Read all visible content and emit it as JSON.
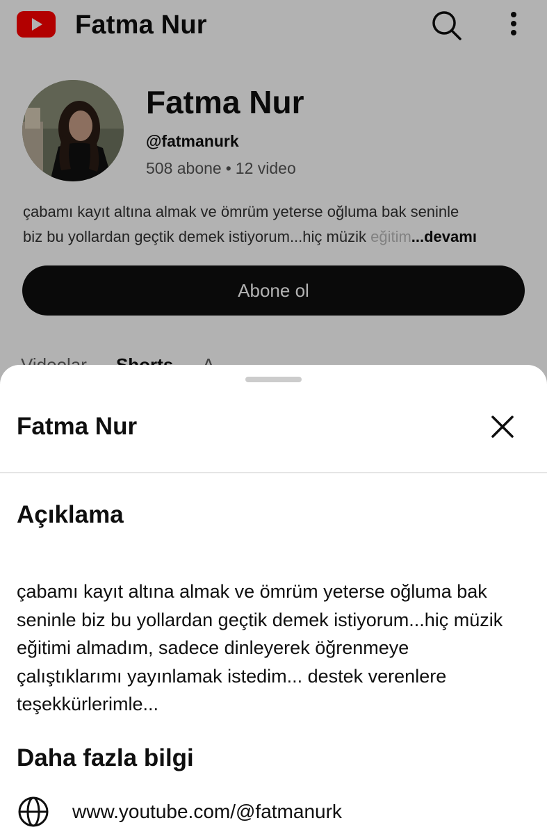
{
  "app": {
    "title": "Fatma Nur",
    "logo_icon": "youtube-logo-icon",
    "brand_color": "#ff0000"
  },
  "channel": {
    "name": "Fatma Nur",
    "handle": "@fatmanurk",
    "subscribers": "508 abone",
    "separator": "•",
    "videos": "12 video",
    "description_line1": "çabamı kayıt altına almak ve ömrüm yeterse oğluma bak seninle",
    "description_line2": "biz bu yollardan geçtik demek istiyorum...hiç müzik ",
    "description_faded": "eğitim",
    "more_label": "...devamı",
    "subscribe_label": "Abone ol",
    "tabs": [
      "Videolar",
      "Shorts",
      "A"
    ]
  },
  "sheet": {
    "title": "Fatma Nur",
    "close_icon": "close-icon",
    "description_heading": "Açıklama",
    "description_lines": [
      "çabamı kayıt altına almak ve ömrüm yeterse oğluma bak",
      "seninle biz bu yollardan geçtik demek istiyorum...hiç müzik",
      "eğitimi almadım, sadece dinleyerek öğrenmeye",
      "çalıştıklarımı yayınlamak istedim... destek verenlere",
      "teşekkürlerimle..."
    ],
    "more_info_heading": "Daha fazla bilgi",
    "link_icon": "globe-icon",
    "link": "www.youtube.com/@fatmanurk"
  }
}
